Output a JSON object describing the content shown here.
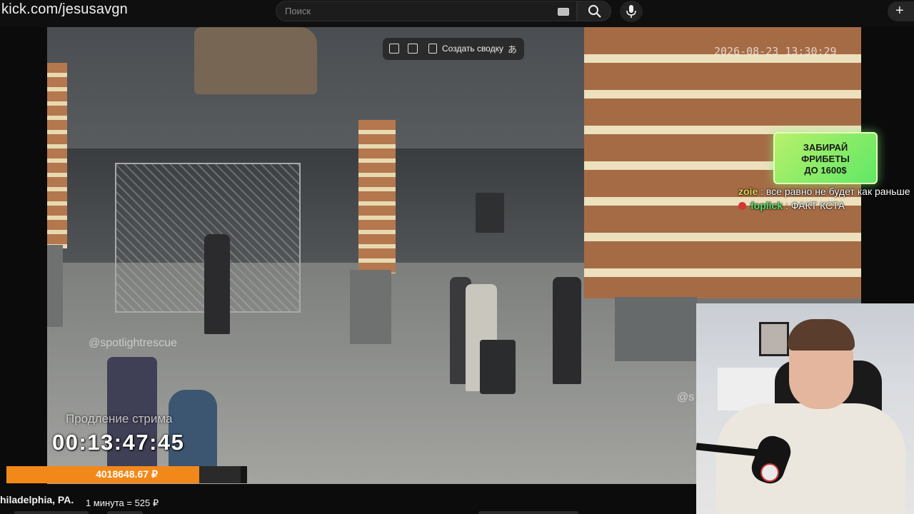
{
  "browser": {
    "url": "kick.com/jesusavgn",
    "search_placeholder": "Поиск",
    "plus_label": "+"
  },
  "video": {
    "timestamp": "2026-08-23 13:30:29",
    "watermark_left": "@spotlightrescue",
    "watermark_right": "@s"
  },
  "toolbar": {
    "summary_label": "Создать сводку",
    "translate_glyph": "あ"
  },
  "promo": {
    "line1": "ЗАБИРАЙ",
    "line2": "ФРИБЕТЫ",
    "line3": "ДО 1600$"
  },
  "chat": [
    {
      "user": "zoie",
      "sep": " : ",
      "text": "все равно не будет как раньше",
      "color": "#e8d65a"
    },
    {
      "user": "foplick",
      "sep": " : ",
      "text": "ФАКТ КСТА",
      "color": "#58e06a"
    }
  ],
  "stream_timer": {
    "label": "Продление стрима",
    "time": "00:13:47:45"
  },
  "goal": {
    "amount": "4018648.67 ₽",
    "progress_fraction": 0.8,
    "color": "#f3881a"
  },
  "bottom": {
    "location": "hiladelphia, PA.",
    "rate": "1 минута = 525 ₽"
  },
  "icons": {
    "search": "search-icon",
    "mic": "mic-icon",
    "keyboard": "keyboard-icon"
  }
}
